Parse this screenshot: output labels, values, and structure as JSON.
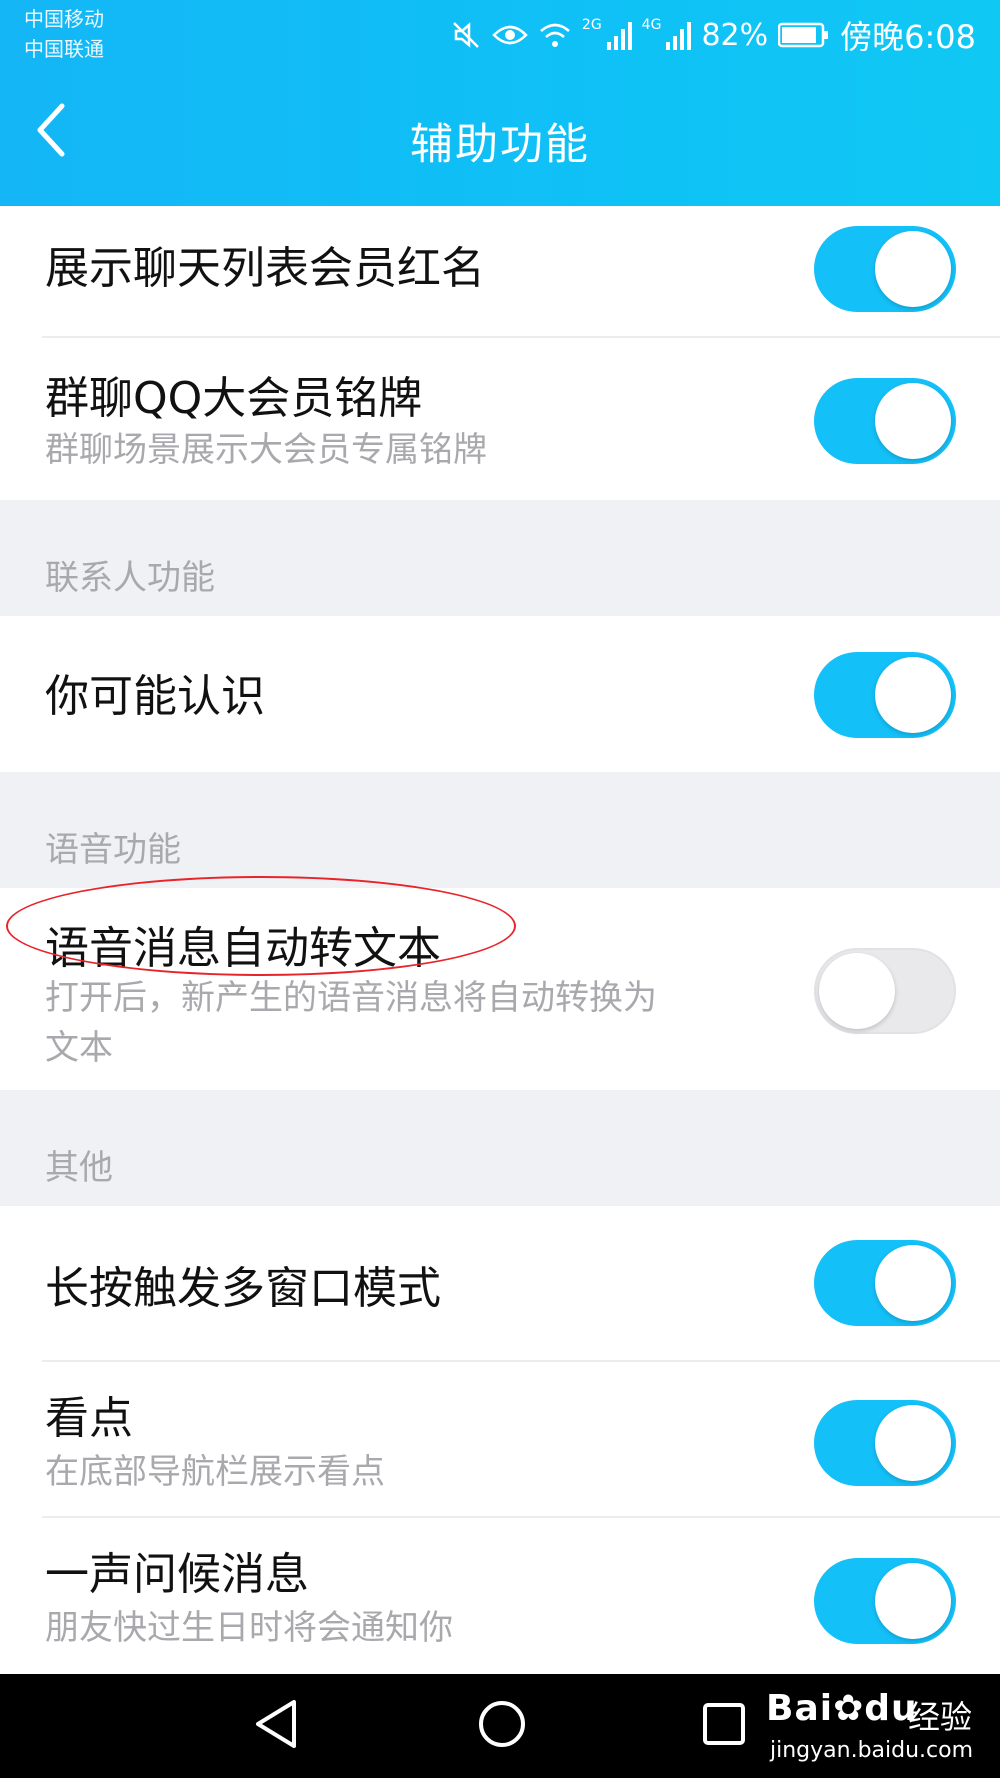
{
  "status_bar": {
    "carrier1": "中国移动",
    "carrier2": "中国联通",
    "net1": "2G",
    "net2": "4G",
    "battery": "82%",
    "time": "傍晚6:08",
    "icons": [
      "mute-icon",
      "eye-icon",
      "wifi-icon",
      "signal-icon",
      "battery-icon"
    ]
  },
  "header": {
    "title": "辅助功能",
    "back_icon": "chevron-left-icon",
    "background": "#14b6f6"
  },
  "rows": [
    {
      "title": "展示聊天列表会员红名",
      "subtitle": "",
      "toggle": true
    },
    {
      "title": "群聊QQ大会员铭牌",
      "subtitle": "群聊场景展示大会员专属铭牌",
      "toggle": true
    }
  ],
  "sections": [
    {
      "label": "联系人功能",
      "rows": [
        {
          "title": "你可能认识",
          "subtitle": "",
          "toggle": true
        }
      ]
    },
    {
      "label": "语音功能",
      "rows": [
        {
          "title": "语音消息自动转文本",
          "subtitle_line1": "打开后，新产生的语音消息将自动转换为",
          "subtitle_line2": "文本",
          "toggle": false
        }
      ]
    },
    {
      "label": "其他",
      "rows": [
        {
          "title": "长按触发多窗口模式",
          "subtitle": "",
          "toggle": true
        },
        {
          "title": "看点",
          "subtitle": "在底部导航栏展示看点",
          "toggle": true
        },
        {
          "title": "一声问候消息",
          "subtitle": "朋友快过生日时将会通知你",
          "toggle": true
        }
      ]
    }
  ],
  "colors": {
    "toggle_on": "#14c0f8",
    "toggle_off": "#e9e9ec",
    "highlight": "#e8242a"
  },
  "system_nav": {
    "icons": [
      "back-triangle-icon",
      "home-circle-icon",
      "recents-square-icon"
    ]
  },
  "watermark": {
    "logo": "Bai",
    "logo_end": "du",
    "jingyan": "经验",
    "url": "jingyan.baidu.com"
  }
}
